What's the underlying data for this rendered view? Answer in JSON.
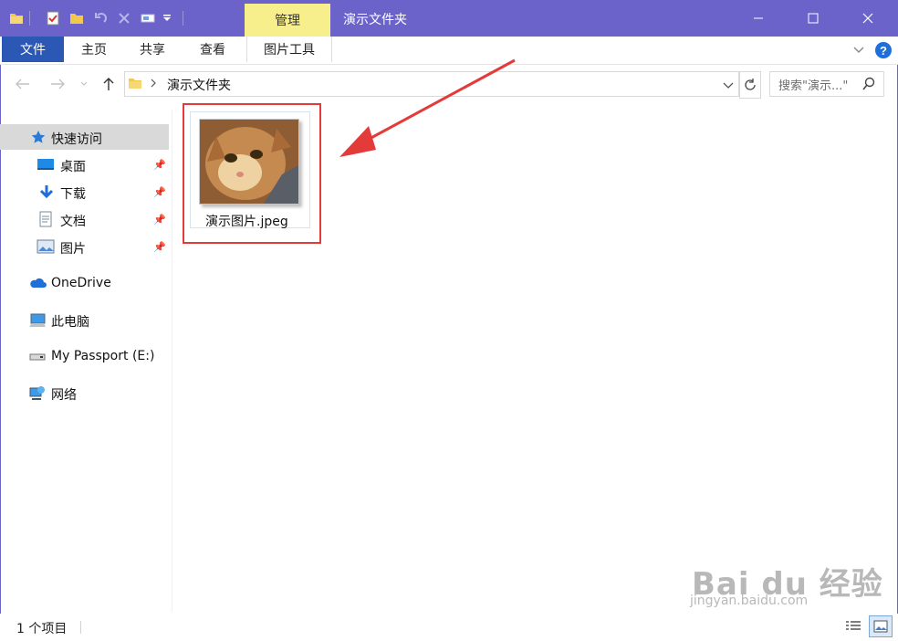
{
  "titlebar": {
    "context_tab": "管理",
    "window_title": "演示文件夹",
    "qa_icons": [
      "folder-icon",
      "properties-icon",
      "new-folder-icon",
      "undo-icon",
      "delete-icon",
      "rename-icon",
      "customize-dropdown-icon"
    ]
  },
  "ribbon": {
    "tabs": [
      "文件",
      "主页",
      "共享",
      "查看",
      "图片工具"
    ]
  },
  "address": {
    "path": "演示文件夹",
    "search_placeholder": "搜索\"演示...\""
  },
  "nav": {
    "quick_access": "快速访问",
    "pinned": [
      {
        "label": "桌面",
        "icon": "desktop-icon"
      },
      {
        "label": "下载",
        "icon": "download-icon"
      },
      {
        "label": "文档",
        "icon": "documents-icon"
      },
      {
        "label": "图片",
        "icon": "pictures-icon"
      }
    ],
    "onedrive": "OneDrive",
    "this_pc": "此电脑",
    "drive": "My Passport (E:)",
    "network": "网络"
  },
  "content": {
    "file_name": "演示图片.jpeg"
  },
  "status": {
    "item_count": "1 个项目"
  },
  "watermark": {
    "brand": "Bai du 经验",
    "url": "jingyan.baidu.com"
  },
  "colors": {
    "titlebar": "#6b63c9",
    "file_tab": "#2b58b5",
    "context_tab": "#f7ef8c",
    "highlight": "#e33a3a"
  }
}
